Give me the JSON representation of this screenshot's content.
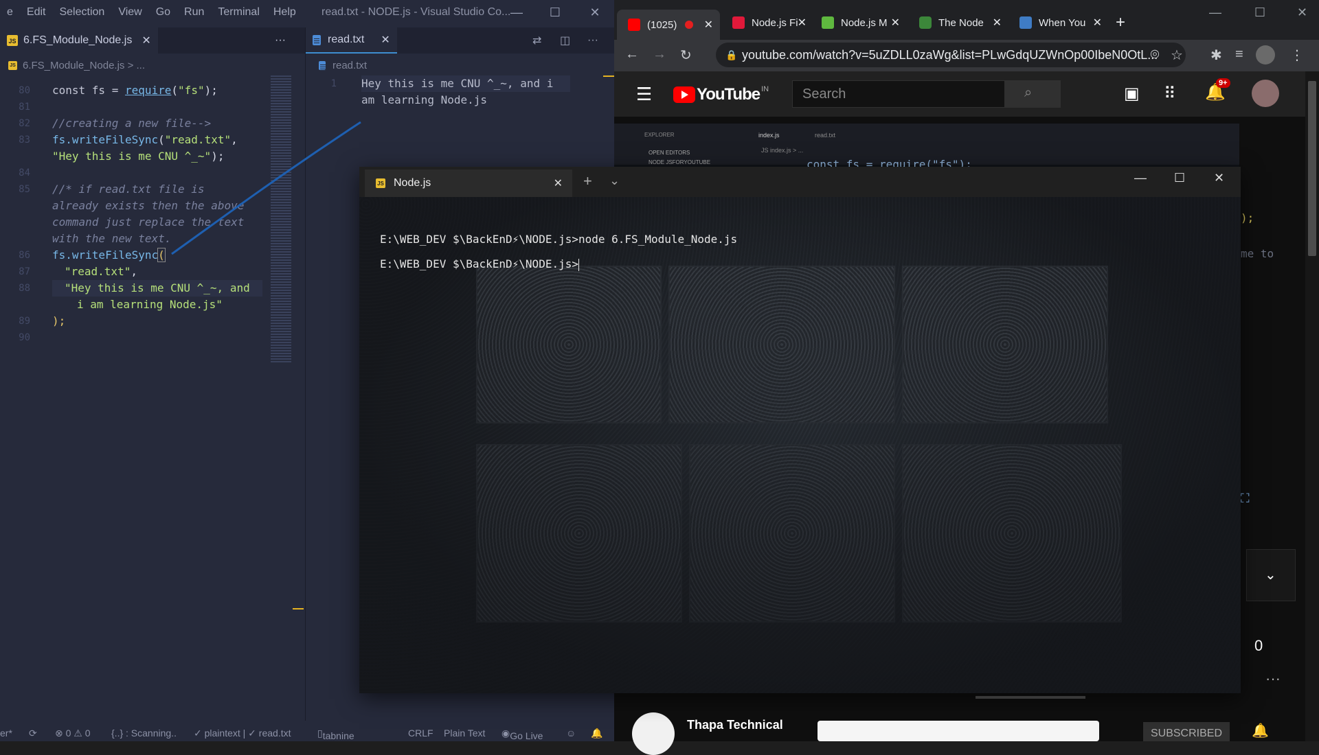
{
  "vscode": {
    "menu": [
      "e",
      "Edit",
      "Selection",
      "View",
      "Go",
      "Run",
      "Terminal",
      "Help"
    ],
    "window_title": "read.txt - NODE.js - Visual Studio Co...",
    "left_tab": {
      "label": "6.FS_Module_Node.js",
      "close": "✕",
      "more": "···"
    },
    "left_breadcrumb": "6.FS_Module_Node.js > ...",
    "right_tab": {
      "label": "read.txt",
      "close": "✕"
    },
    "right_breadcrumb": "read.txt",
    "code_lines": [
      {
        "num": "80"
      },
      {
        "num": "81"
      },
      {
        "num": "82"
      },
      {
        "num": "83"
      },
      {
        "num": ""
      },
      {
        "num": "84"
      },
      {
        "num": "85"
      },
      {
        "num": ""
      },
      {
        "num": ""
      },
      {
        "num": ""
      },
      {
        "num": "86"
      },
      {
        "num": "87"
      },
      {
        "num": "88"
      },
      {
        "num": ""
      },
      {
        "num": "89"
      },
      {
        "num": "90"
      }
    ],
    "code": {
      "l80_kw": "const fs = ",
      "l80_fn": "require",
      "l80_str": "\"fs\"",
      "l80_end": ");",
      "l82": "//creating a new file-->",
      "l83_fn": "fs.writeFileSync",
      "l83_str": "\"read.txt\"",
      "l83b_str": "\"Hey this is me CNU ^_~\"",
      "l85a": "//* if read.txt file is",
      "l85b": "already exists then the above",
      "l85c": "command just replace the text",
      "l85d": "with the new text.",
      "l86_fn": "fs.writeFileSync",
      "l87_str": "\"read.txt\"",
      "l88a_str": "\"Hey this is me CNU ^_~, and",
      "l88b_str": "i am learning Node.js\"",
      "l89": ");"
    },
    "readtxt": {
      "line_num": "1",
      "line_a": "Hey this is me CNU ^_~, and i",
      "line_b": "am learning Node.js"
    },
    "status": {
      "left_cut": "er*",
      "problems": "⊗ 0 ⚠ 0",
      "scanning": "{..} : Scanning..",
      "plaintext": "✓ plaintext | ✓ read.txt",
      "tabnine": "tabnine",
      "crlf": "CRLF",
      "lang": "Plain Text",
      "golive": "Go Live"
    }
  },
  "chrome": {
    "tabs": [
      {
        "label": "(1025)",
        "icon_color": "#ff0000"
      },
      {
        "label": "Node.js Fi",
        "icon_color": "#e0193a"
      },
      {
        "label": "Node.js M",
        "icon_color": "#5fb83f"
      },
      {
        "label": "The Node",
        "icon_color": "#3c873a"
      },
      {
        "label": "When You",
        "icon_color": "#3f7cc5"
      }
    ],
    "new_tab": "+",
    "url": "youtube.com/watch?v=5uZDLL0zaWg&list=PLwGdqUZWnOp00IbeN0OtL...",
    "youtube": {
      "logo": "YouTube",
      "country": "IN",
      "search_placeholder": "Search",
      "notif_badge": "9+",
      "channel_name": "Thapa Technical",
      "subscribe": "SUBSCRIBED",
      "count_digit": "0",
      "embedded_explorer": "EXPLORER",
      "embedded_tab1": "index.js",
      "embedded_tab2": "read.txt",
      "embedded_open_editors": "OPEN EDITORS",
      "embedded_folder": "NODE JSFORYOUTUBE",
      "embedded_code": "const fs = require(\"fs\");",
      "embedded_crumb": "JS index.js > ...",
      "embedded_frag1": ");",
      "embedded_frag2": "me to"
    }
  },
  "terminal": {
    "tab_label": "Node.js",
    "line1": "E:\\WEB_DEV $\\BackEnD⚡\\NODE.js>node 6.FS_Module_Node.js",
    "line2": "E:\\WEB_DEV $\\BackEnD⚡\\NODE.js>"
  }
}
